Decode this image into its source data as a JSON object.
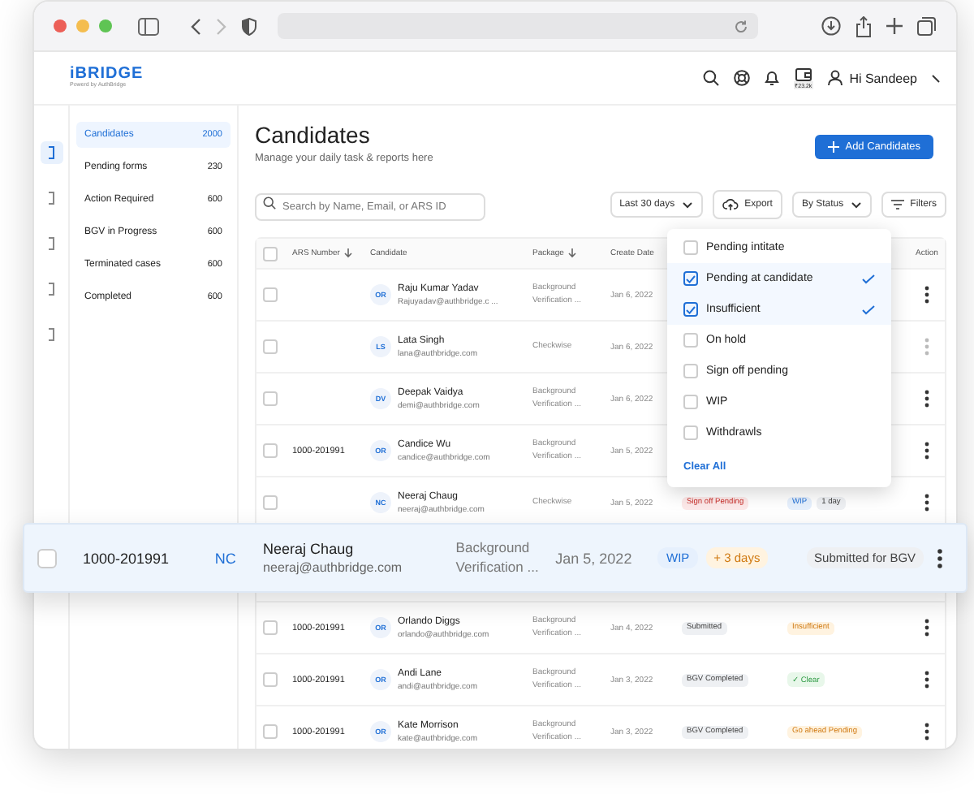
{
  "browser": {
    "forward_disabled": true
  },
  "header": {
    "logo": "iBRIDGE",
    "tagline": "Powerd by AuthBridge",
    "wallet": "₹23.2k",
    "greeting": "Hi Sandeep"
  },
  "rail": [
    {
      "selected": true
    },
    {
      "selected": false
    },
    {
      "selected": false
    },
    {
      "selected": false
    },
    {
      "selected": false
    }
  ],
  "sidebar": {
    "items": [
      {
        "label": "Candidates",
        "count": "2000",
        "selected": true
      },
      {
        "label": "Pending forms",
        "count": "230",
        "selected": false
      },
      {
        "label": "Action Required",
        "count": "600",
        "selected": false
      },
      {
        "label": "BGV in Progress",
        "count": "600",
        "selected": false
      },
      {
        "label": "Terminated cases",
        "count": "600",
        "selected": false
      },
      {
        "label": "Completed",
        "count": "600",
        "selected": false
      }
    ]
  },
  "page": {
    "title": "Candidates",
    "subtitle": "Manage your daily task & reports here",
    "add_button": "Add Candidates"
  },
  "toolbar": {
    "search": {
      "placeholder": "Search by Name, Email, or ARS ID"
    },
    "date_range": "Last 30 days",
    "export": "Export",
    "status_filter": "By Status",
    "filters": "Filters"
  },
  "table": {
    "select_all_checked": false,
    "columns": [
      {
        "label": "ARS Number",
        "sorted": true
      },
      {
        "label": "Candidate",
        "sorted": false
      },
      {
        "label": "Package",
        "sorted": true
      },
      {
        "label": "Create Date",
        "sorted": false
      },
      {
        "label": "Action",
        "sorted": false
      }
    ],
    "rows": [
      {
        "checked": false,
        "ars": "",
        "initials": "OR",
        "name": "Raju Kumar Yadav",
        "email": "Rajuyadav@authbridge.c ...",
        "package": "Background Verification ...",
        "date": "Jan 6, 2022",
        "status_tags": [],
        "result_tags": [],
        "action_disabled": false
      },
      {
        "checked": false,
        "ars": "",
        "initials": "LS",
        "name": "Lata Singh",
        "email": "lana@authbridge.com",
        "package": "Checkwise",
        "date": "Jan 6, 2022",
        "status_tags": [],
        "result_tags": [],
        "action_disabled": true
      },
      {
        "checked": false,
        "ars": "",
        "initials": "DV",
        "name": "Deepak Vaidya",
        "email": "demi@authbridge.com",
        "package": "Background Verification ...",
        "date": "Jan 6, 2022",
        "status_tags": [],
        "result_tags": [],
        "action_disabled": false
      },
      {
        "checked": false,
        "ars": "1000-201991",
        "initials": "OR",
        "name": "Candice Wu",
        "email": "candice@authbridge.com",
        "package": "Background Verification ...",
        "date": "Jan 5, 2022",
        "status_tags": [],
        "result_tags": [],
        "action_disabled": false
      },
      {
        "checked": false,
        "ars": "",
        "initials": "NC",
        "name": "Neeraj Chaug",
        "email": "neeraj@authbridge.com",
        "package": "Checkwise",
        "date": "Jan 5, 2022",
        "status_tags": [
          {
            "label": "Sign off Pending",
            "kind": "danger"
          }
        ],
        "result_tags": [
          {
            "label": "WIP",
            "kind": "info"
          },
          {
            "label": "1 day",
            "kind": "neutral"
          }
        ],
        "action_disabled": false
      },
      {
        "kind": "gap"
      },
      {
        "checked": false,
        "ars": "1000-201991",
        "initials": "OR",
        "name": "Orlando Diggs",
        "email": "orlando@authbridge.com",
        "package": "Background Verification ...",
        "date": "Jan 4, 2022",
        "status_tags": [
          {
            "label": "Submitted",
            "kind": "neutral"
          }
        ],
        "result_tags": [
          {
            "label": "Insufficient",
            "kind": "warning"
          }
        ],
        "action_disabled": false
      },
      {
        "checked": false,
        "ars": "1000-201991",
        "initials": "OR",
        "name": "Andi Lane",
        "email": "andi@authbridge.com",
        "package": "Background Verification ...",
        "date": "Jan 3, 2022",
        "status_tags": [
          {
            "label": "BGV Completed",
            "kind": "neutral"
          }
        ],
        "result_tags": [
          {
            "label": "✓ Clear",
            "kind": "success"
          }
        ],
        "action_disabled": false
      },
      {
        "checked": false,
        "ars": "1000-201991",
        "initials": "OR",
        "name": "Kate Morrison",
        "email": "kate@authbridge.com",
        "package": "Background Verification ...",
        "date": "Jan 3, 2022",
        "status_tags": [
          {
            "label": "BGV Completed",
            "kind": "neutral"
          }
        ],
        "result_tags": [
          {
            "label": "Go ahead Pending",
            "kind": "warning"
          }
        ],
        "action_disabled": false
      }
    ]
  },
  "status_menu": {
    "options": [
      {
        "label": "Pending intitate",
        "checked": false
      },
      {
        "label": "Pending at candidate",
        "checked": true
      },
      {
        "label": "Insufficient",
        "checked": true
      },
      {
        "label": "On hold",
        "checked": false
      },
      {
        "label": "Sign off pending",
        "checked": false
      },
      {
        "label": "WIP",
        "checked": false
      },
      {
        "label": "Withdrawls",
        "checked": false
      }
    ],
    "clear": "Clear All"
  },
  "lifted_row": {
    "checked": false,
    "ars": "1000-201991",
    "initials": "NC",
    "name": "Neeraj Chaug",
    "email": "neeraj@authbridge.com",
    "package": "Background Verification ...",
    "date": "Jan 5, 2022",
    "tags": [
      {
        "label": "WIP",
        "kind": "info"
      },
      {
        "label": "+ 3 days",
        "kind": "warning"
      }
    ],
    "status": {
      "label": "Submitted for BGV",
      "kind": "neutral"
    }
  }
}
